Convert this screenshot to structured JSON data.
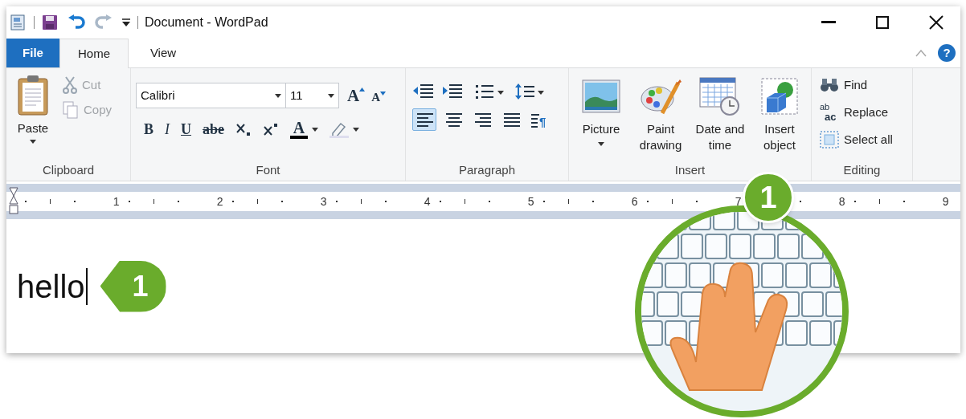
{
  "window": {
    "title": "Document - WordPad"
  },
  "tabs": [
    {
      "label": "File",
      "kind": "file",
      "selected": false
    },
    {
      "label": "Home",
      "kind": "tab",
      "selected": true
    },
    {
      "label": "View",
      "kind": "tab",
      "selected": false
    }
  ],
  "clipboard": {
    "label": "Clipboard",
    "paste": "Paste",
    "items": [
      {
        "label": "Cut",
        "kind": "cut",
        "disabled": true
      },
      {
        "label": "Copy",
        "kind": "copy",
        "disabled": true
      }
    ]
  },
  "help": {
    "label": "?"
  },
  "font": {
    "label": "Font",
    "font_name": "Calibri",
    "font_size": "11",
    "grow": "A",
    "shrink": "A",
    "buttons": [
      {
        "label": "B",
        "kind": "bold"
      },
      {
        "label": "I",
        "kind": "italic"
      },
      {
        "label": "U",
        "kind": "underline"
      },
      {
        "label": "abe",
        "kind": "strike"
      }
    ],
    "text_color": "A"
  },
  "paragraph": {
    "label": "Paragraph",
    "settings_mark": "¶",
    "alignments": [
      {
        "kind": "left",
        "selected": true
      },
      {
        "kind": "center",
        "selected": false
      },
      {
        "kind": "right",
        "selected": false
      },
      {
        "kind": "justify",
        "selected": false
      }
    ]
  },
  "insert": {
    "label": "Insert",
    "buttons": [
      {
        "label": "Picture",
        "kind": "picture",
        "dropdown": true
      },
      {
        "label": "Paint drawing",
        "kind": "paint",
        "dropdown": false
      },
      {
        "label": "Date and time",
        "kind": "datetime",
        "dropdown": false
      },
      {
        "label": "Insert object",
        "kind": "object",
        "dropdown": false
      }
    ]
  },
  "editing": {
    "label": "Editing",
    "buttons": [
      {
        "label": "Find",
        "kind": "find"
      },
      {
        "label": "Replace",
        "kind": "replace",
        "icon_top": "ab",
        "icon_bottom": "ac"
      },
      {
        "label": "Select all",
        "kind": "selectall"
      }
    ]
  },
  "ruler": {
    "numbers": [
      "1",
      "2",
      "3",
      "4",
      "5",
      "6",
      "7",
      "8",
      "9"
    ]
  },
  "document": {
    "text": "hello"
  },
  "callouts": [
    {
      "label": "1",
      "kind": "pointer"
    },
    {
      "label": "1",
      "kind": "badge"
    }
  ]
}
